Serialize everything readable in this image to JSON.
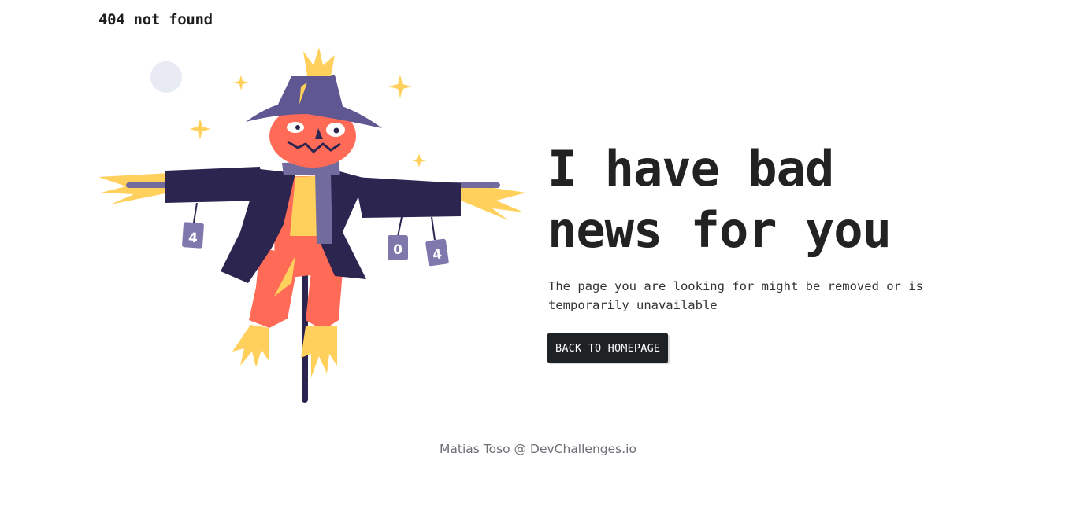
{
  "header": {
    "logo_text": "404 not found"
  },
  "main": {
    "headline_line1": "I have bad",
    "headline_line2": "news for you",
    "message": "The page you are looking for might be removed or is temporarily unavailable",
    "cta_label": "BACK TO HOMEPAGE"
  },
  "illustration": {
    "can_labels": [
      "4",
      "0",
      "4"
    ],
    "colors": {
      "hat": "#5e5791",
      "coat": "#2b2550",
      "face": "#ff6b57",
      "straw": "#ffd15c",
      "scarf": "#716b9e",
      "moon": "#e8eaf4",
      "can": "#7e78ac"
    }
  },
  "footer": {
    "credit": "Matias Toso @ DevChallenges.io"
  },
  "theme": {
    "text": "#1f1f1f",
    "button_bg": "#1f2225",
    "button_text": "#ffffff",
    "footer_text": "#6b6f75"
  }
}
